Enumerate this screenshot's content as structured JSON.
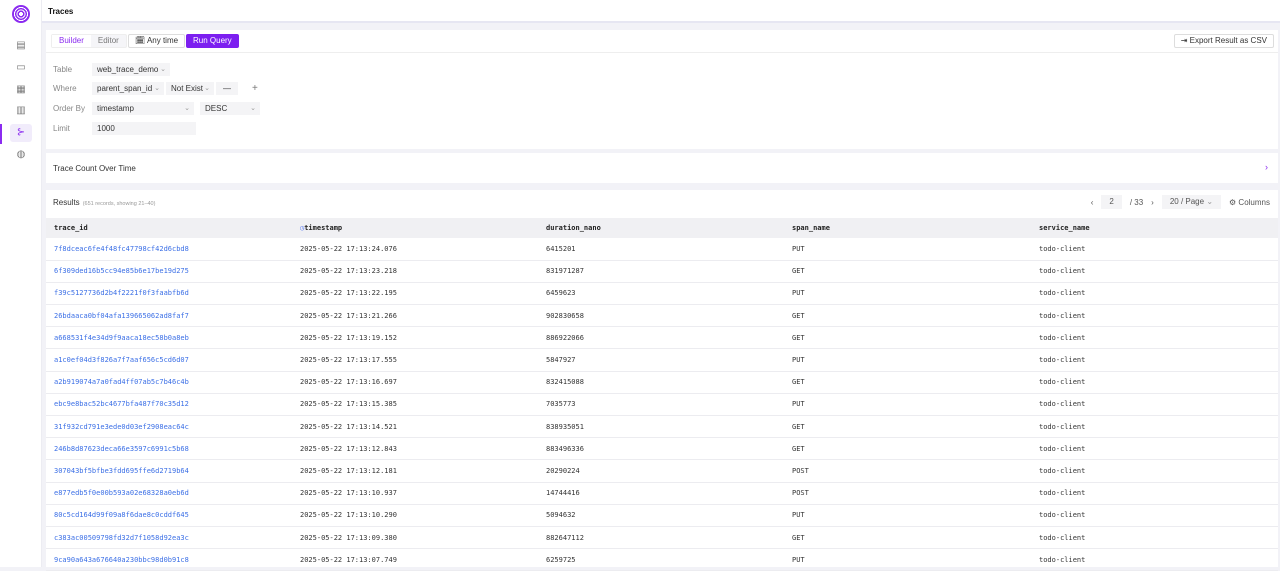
{
  "header": {
    "title": "Traces"
  },
  "sidebar": {
    "items": [
      "dashboard-icon",
      "folder-icon",
      "notebook-icon",
      "table-icon",
      "traces-icon",
      "monitor-icon"
    ],
    "active": 4
  },
  "toolbar": {
    "builder": "Builder",
    "editor": "Editor",
    "time": "Any time",
    "run": "Run Query",
    "export": "Export Result as CSV"
  },
  "query": {
    "table_label": "Table",
    "table": "web_trace_demo",
    "where_label": "Where",
    "where_field": "parent_span_id",
    "where_op": "Not Exist",
    "where_value": "—",
    "add": "+",
    "order_label": "Order By",
    "order_field": "timestamp",
    "order_dir": "DESC",
    "limit_label": "Limit",
    "limit": "1000"
  },
  "chart_section": {
    "title": "Trace Count Over Time"
  },
  "results": {
    "title": "Results",
    "summary": "(651 records, showing 21–40)",
    "page": "2",
    "total_pages": "/ 33",
    "page_size": "20 / Page",
    "columns_btn": "Columns",
    "headers": [
      "trace_id",
      "timestamp",
      "duration_nano",
      "span_name",
      "service_name"
    ],
    "rows": [
      [
        "7f8dceac6fe4f48fc47798cf42d6cbd8",
        "2025-05-22 17:13:24.076",
        "6415201",
        "PUT",
        "todo-client"
      ],
      [
        "6f309ded16b5cc94e85b6e17be19d275",
        "2025-05-22 17:13:23.218",
        "831971287",
        "GET",
        "todo-client"
      ],
      [
        "f39c5127736d2b4f2221f0f3faabfb6d",
        "2025-05-22 17:13:22.195",
        "6459623",
        "PUT",
        "todo-client"
      ],
      [
        "26bdaaca0bf04afa139665062ad8faf7",
        "2025-05-22 17:13:21.266",
        "902830658",
        "GET",
        "todo-client"
      ],
      [
        "a668531f4e34d9f9aaca18ec58b0a8eb",
        "2025-05-22 17:13:19.152",
        "886922066",
        "GET",
        "todo-client"
      ],
      [
        "a1c0ef04d3f826a7f7aaf656c5cd6d07",
        "2025-05-22 17:13:17.555",
        "5847927",
        "PUT",
        "todo-client"
      ],
      [
        "a2b919074a7a0fad4ff07ab5c7b46c4b",
        "2025-05-22 17:13:16.697",
        "832415088",
        "GET",
        "todo-client"
      ],
      [
        "ebc9e8bac52bc4677bfa487f70c35d12",
        "2025-05-22 17:13:15.385",
        "7035773",
        "PUT",
        "todo-client"
      ],
      [
        "31f932cd791e3ede0d03ef2908eac64c",
        "2025-05-22 17:13:14.521",
        "838935051",
        "GET",
        "todo-client"
      ],
      [
        "246b8d87623deca66e3597c6991c5b68",
        "2025-05-22 17:13:12.843",
        "883496336",
        "GET",
        "todo-client"
      ],
      [
        "307043bf5bfbe3fdd695ffe6d2719b64",
        "2025-05-22 17:13:12.181",
        "20290224",
        "POST",
        "todo-client"
      ],
      [
        "e877edb5f0e00b593a02e68328a0eb6d",
        "2025-05-22 17:13:10.937",
        "14744416",
        "POST",
        "todo-client"
      ],
      [
        "80c5cd164d99f09a8f6dae8c0cddf645",
        "2025-05-22 17:13:10.290",
        "5094632",
        "PUT",
        "todo-client"
      ],
      [
        "c383ac00509798fd32d7f1058d92ea3c",
        "2025-05-22 17:13:09.380",
        "882647112",
        "GET",
        "todo-client"
      ],
      [
        "9ca90a643a676640a230bbc98d0b91c8",
        "2025-05-22 17:13:07.749",
        "6259725",
        "PUT",
        "todo-client"
      ]
    ]
  }
}
